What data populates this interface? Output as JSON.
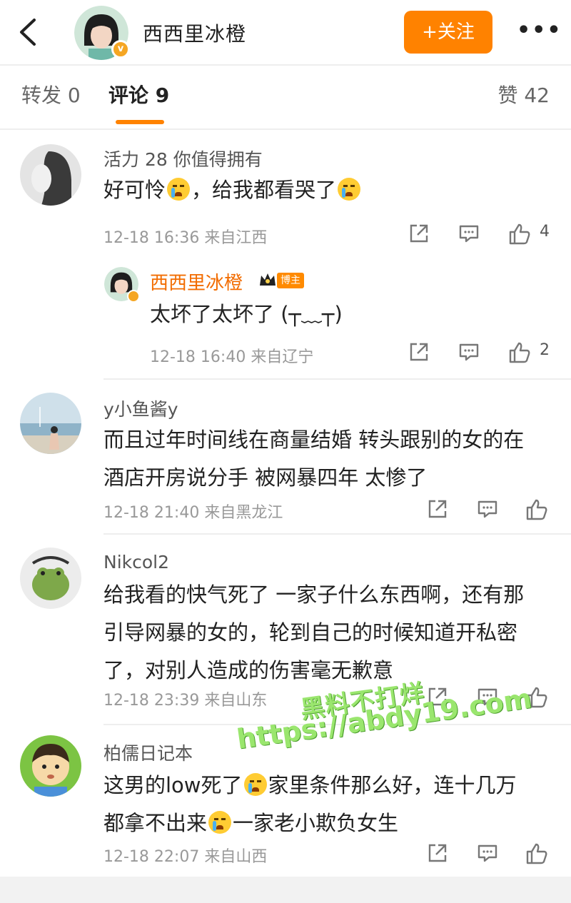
{
  "header": {
    "account_name": "西西里冰橙",
    "follow_label": "+关注",
    "more_label": "•••",
    "verified_mark": "v"
  },
  "tabs": {
    "repost": "转发 0",
    "comment": "评论 9",
    "likes": "赞 42"
  },
  "comments": [
    {
      "username": "活力 28 你值得拥有",
      "text_parts": [
        "好可怜",
        "，给我都看哭了",
        ""
      ],
      "meta": "12-18 16:36 来自江西",
      "like_count": "4",
      "reply": {
        "username": "西西里冰橙",
        "badge": "博主",
        "text": "太坏了太坏了 (┬﹏┬)",
        "meta": "12-18 16:40 来自辽宁",
        "like_count": "2"
      }
    },
    {
      "username": "y小鱼酱y",
      "line1": "而且过年时间线在商量结婚 转头跟别的女的在",
      "line2": "酒店开房说分手 被网暴四年 太惨了",
      "meta": "12-18 21:40 来自黑龙江"
    },
    {
      "username": "Nikcol2",
      "line1": "给我看的快气死了 一家子什么东西啊，还有那",
      "line2": "引导网暴的女的，轮到自己的时候知道开私密",
      "line3": "了，对别人造成的伤害毫无歉意",
      "meta": "12-18 23:39 来自山东"
    },
    {
      "username": "柏儒日记本",
      "line1a": "这男的low死了",
      "line1b": "家里条件那么好，连十几万",
      "line2a": "都拿不出来",
      "line2b": "一家老小欺负女生",
      "meta": "12-18 22:07 来自山西"
    }
  ],
  "watermark": {
    "line1": "黑料不打烊",
    "line2": "https://abdy19.com"
  },
  "colors": {
    "accent": "#ff8200",
    "reply_name": "#f26c00",
    "meta": "#999999"
  }
}
